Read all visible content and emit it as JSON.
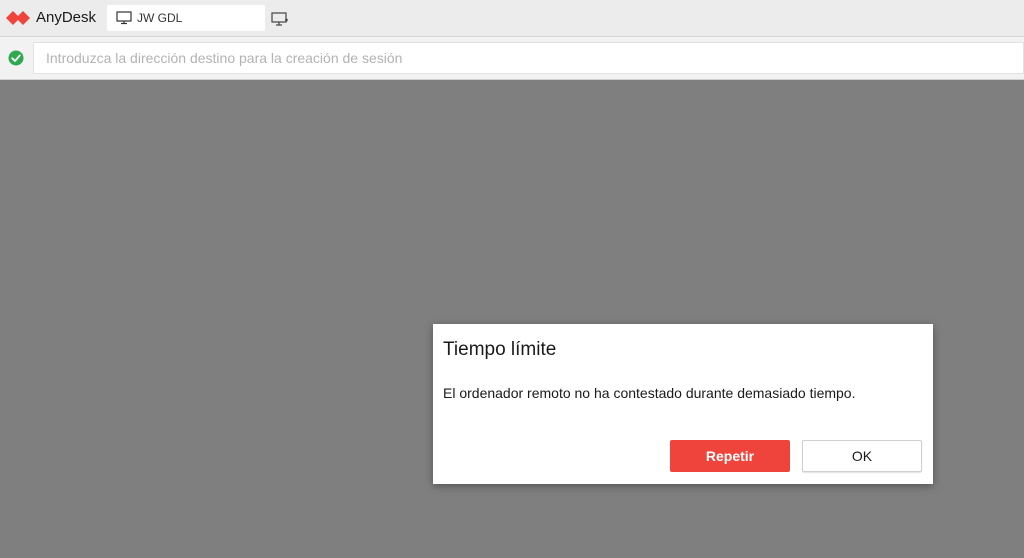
{
  "app": {
    "name": "AnyDesk",
    "brand_color": "#ef443b"
  },
  "tabs": [
    {
      "label": "JW GDL",
      "icon": "monitor-icon"
    }
  ],
  "toolbar": {
    "new_session_icon": "new-session-monitor-icon"
  },
  "address_bar": {
    "status_icon": "check-circle-icon",
    "status_color": "#2fa84f",
    "value": "",
    "placeholder": "Introduzca la dirección destino para la creación de sesión"
  },
  "dialog": {
    "title": "Tiempo límite",
    "message": "El ordenador remoto no ha contestado durante demasiado tiempo.",
    "buttons": {
      "retry_label": "Repetir",
      "ok_label": "OK"
    }
  }
}
